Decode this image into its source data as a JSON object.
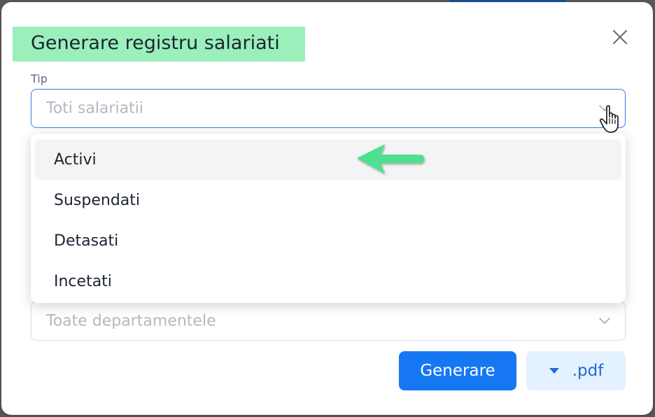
{
  "modal": {
    "title": "Generare registru salariati"
  },
  "tip_field": {
    "label": "Tip",
    "placeholder": "Toti salariatii"
  },
  "dropdown": {
    "options": [
      {
        "label": "Activi",
        "highlighted": true
      },
      {
        "label": "Suspendati",
        "highlighted": false
      },
      {
        "label": "Detasati",
        "highlighted": false
      },
      {
        "label": "Incetati",
        "highlighted": false
      }
    ]
  },
  "department_field": {
    "placeholder": "Toate departamentele"
  },
  "actions": {
    "generate_label": "Generare",
    "format_label": ".pdf"
  },
  "colors": {
    "primary": "#1677f2",
    "title_highlight": "#9aefba",
    "annotation_arrow": "#4ee08e",
    "focus_border": "#2f7fe8",
    "format_button_bg": "#e4f1fe"
  },
  "icons": {
    "close": "close-icon",
    "chevron": "chevron-down-icon",
    "caret": "caret-down-icon",
    "cursor": "hand-pointer-icon",
    "annotation": "arrow-left-icon"
  }
}
